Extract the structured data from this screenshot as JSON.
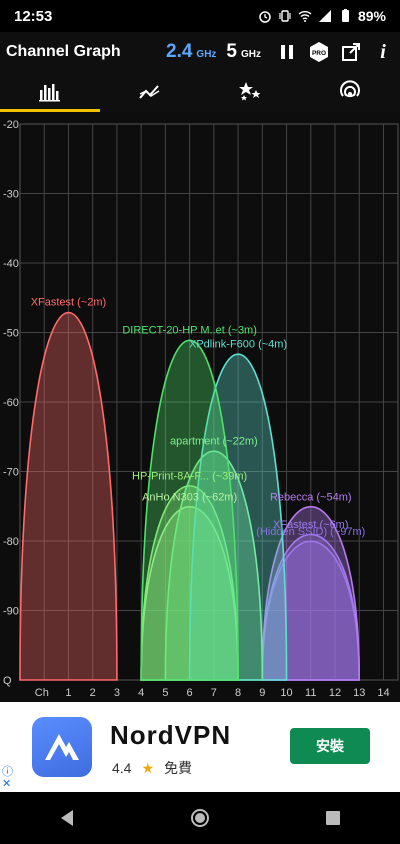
{
  "status": {
    "time": "12:53",
    "battery": "89%"
  },
  "appbar": {
    "title": "Channel Graph",
    "band_24": "2.4",
    "band_24_unit": "GHz",
    "band_5": "5",
    "band_5_unit": "GHz",
    "pro_label": "PRO",
    "info_label": "i"
  },
  "tabs": [
    {
      "icon": "bar-chart-icon"
    },
    {
      "icon": "time-graph-icon"
    },
    {
      "icon": "stars-icon"
    },
    {
      "icon": "signal-icon"
    }
  ],
  "chart_data": {
    "type": "area",
    "y_tick_labels": [
      "-20",
      "-30",
      "-40",
      "-50",
      "-60",
      "-70",
      "-80",
      "-90",
      "Q"
    ],
    "x_tick_labels": [
      "Ch",
      "1",
      "2",
      "3",
      "4",
      "5",
      "6",
      "7",
      "8",
      "9",
      "10",
      "11",
      "12",
      "13",
      "14"
    ],
    "ylim": [
      -100,
      -20
    ],
    "xlim": [
      -1,
      14.6
    ],
    "grid": true,
    "series": [
      {
        "name": "XFastest (~2m)",
        "center": 1,
        "width": 2,
        "peak": -47,
        "color": "#ff6a6a"
      },
      {
        "name": "DIRECT-20-HP M..et (~3m)",
        "center": 6,
        "width": 2,
        "peak": -51,
        "color": "#4fe06a"
      },
      {
        "name": "XPdlink-F600 (~4m)",
        "center": 8,
        "width": 2,
        "peak": -53,
        "color": "#5fe0d0"
      },
      {
        "name": "apartment (~22m)",
        "center": 7,
        "width": 2,
        "peak": -67,
        "color": "#7cf08c"
      },
      {
        "name": "HP-Print-8A-F... (~39m)",
        "center": 6,
        "width": 2,
        "peak": -72,
        "color": "#9cf07a"
      },
      {
        "name": "AnHo N303 (~62m)",
        "center": 6,
        "width": 2,
        "peak": -75,
        "color": "#b8f0a0"
      },
      {
        "name": "Rebecca (~54m)",
        "center": 11,
        "width": 2,
        "peak": -75,
        "color": "#b77af0"
      },
      {
        "name": "XFastest (~6m)",
        "center": 11,
        "width": 2,
        "peak": -79,
        "color": "#9a7af0"
      },
      {
        "name": "(Hidden SSID) (~97m)",
        "center": 11,
        "width": 2,
        "peak": -80,
        "color": "#8a6fe8"
      }
    ]
  },
  "ad": {
    "name": "NordVPN",
    "rating": "4.4",
    "star": "★",
    "price": "免費",
    "install": "安裝",
    "info": "ⓘ",
    "close": "✕"
  }
}
